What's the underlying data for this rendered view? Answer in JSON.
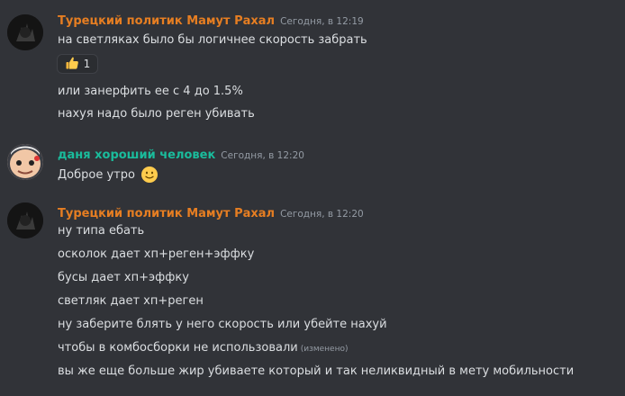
{
  "messages": [
    {
      "username": "Турецкий политик Мамут Рахал",
      "timestamp": "Сегодня, в 12:19",
      "username_color": "#e67e22",
      "lines": [
        "на светляках было бы логичнее скорость забрать",
        "или занерфить ее с 4 до 1.5%",
        "нахуя надо было реген убивать"
      ],
      "reaction": {
        "emoji": "thumbs-up",
        "count": "1"
      }
    },
    {
      "username": "даня хороший человек",
      "timestamp": "Сегодня, в 12:20",
      "username_color": "#1abc9c",
      "lines": [
        "Доброе утро"
      ],
      "inline_emoji": "slightly-smiling-face"
    },
    {
      "username": "Турецкий политик Мамут Рахал",
      "timestamp": "Сегодня, в 12:20",
      "username_color": "#e67e22",
      "lines": [
        "ну типа ебать",
        "осколок дает хп+реген+эффку",
        "бусы дает хп+эффку",
        "светляк дает хп+реген",
        "ну заберите блять у него скорость или убейте нахуй",
        "чтобы в комбосборки не использовали",
        "вы же еще больше жир убиваете который и так неликвидный в мету мобильности"
      ],
      "edited_label": "(изменено)"
    }
  ],
  "colors": {
    "background": "#313338",
    "text": "#dbdee1",
    "muted": "#949ba4"
  }
}
